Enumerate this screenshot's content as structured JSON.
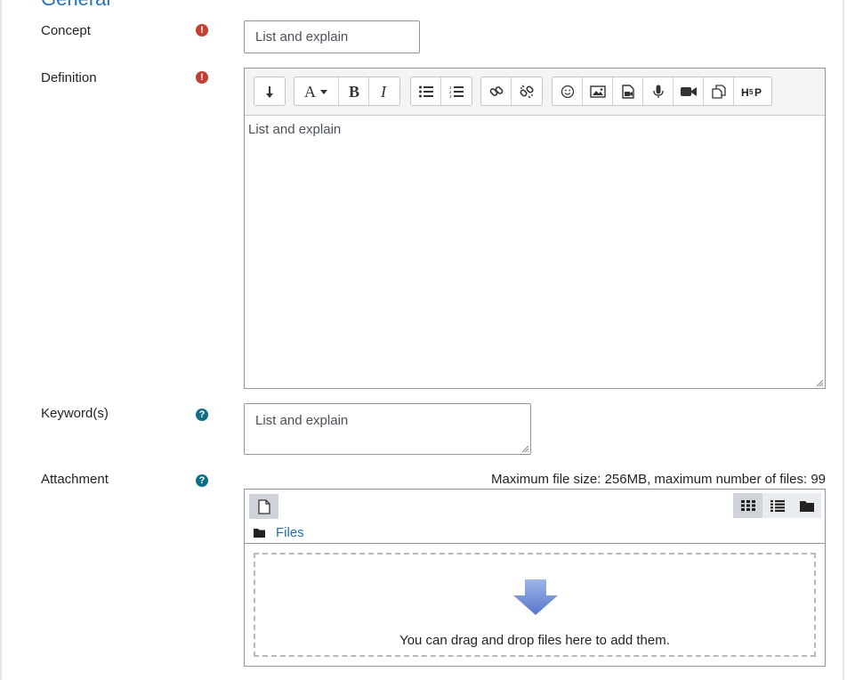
{
  "section": {
    "legend": "General"
  },
  "concept": {
    "label": "Concept",
    "value": "List and explain"
  },
  "definition": {
    "label": "Definition",
    "content": "List and explain",
    "toolbar": {
      "groups": [
        [
          {
            "name": "show-more-buttons",
            "icon": "collapse-icon"
          }
        ],
        [
          {
            "name": "font-style",
            "icon": "font-style-icon"
          },
          {
            "name": "bold",
            "icon": "bold-icon"
          },
          {
            "name": "italic",
            "icon": "italic-icon"
          }
        ],
        [
          {
            "name": "unordered-list",
            "icon": "bulleted-list-icon"
          },
          {
            "name": "ordered-list",
            "icon": "numbered-list-icon"
          }
        ],
        [
          {
            "name": "link",
            "icon": "link-icon"
          },
          {
            "name": "unlink",
            "icon": "unlink-icon"
          }
        ],
        [
          {
            "name": "emoticon",
            "icon": "smiley-icon"
          },
          {
            "name": "image",
            "icon": "image-icon"
          },
          {
            "name": "media",
            "icon": "media-file-icon"
          },
          {
            "name": "record-audio",
            "icon": "microphone-icon"
          },
          {
            "name": "record-video",
            "icon": "video-camera-icon"
          },
          {
            "name": "manage-files",
            "icon": "files-icon"
          },
          {
            "name": "h5p",
            "icon": "h5p-icon"
          }
        ]
      ]
    }
  },
  "keywords": {
    "label": "Keyword(s)",
    "value": "List and explain"
  },
  "attachment": {
    "label": "Attachment",
    "max_info": "Maximum file size: 256MB, maximum number of files: 99",
    "path_label": "Files",
    "drop_text": "You can drag and drop files here to add them."
  },
  "colors": {
    "accent": "#1f6fb5",
    "required": "#c43f31",
    "help": "#0f6e8a"
  }
}
